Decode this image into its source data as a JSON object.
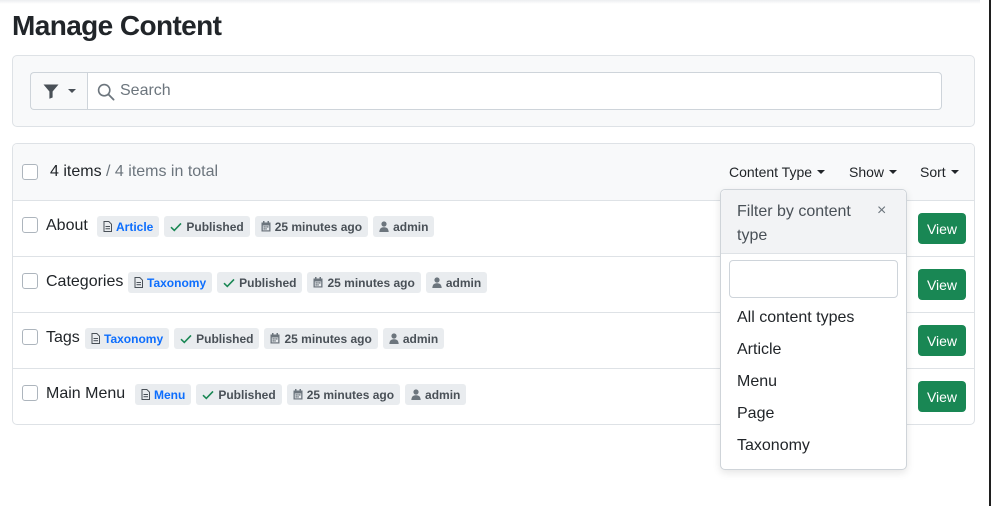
{
  "page": {
    "title": "Manage Content"
  },
  "search": {
    "placeholder": "Search"
  },
  "list": {
    "count_label": "4 items",
    "total_label": " / 4 items in total",
    "controls": {
      "content_type": "Content Type",
      "show": "Show",
      "sort": "Sort"
    },
    "rows": [
      {
        "title": "About",
        "type": "Article",
        "status": "Published",
        "date": "25 minutes ago",
        "author": "admin",
        "action": "View"
      },
      {
        "title": "Categories",
        "type": "Taxonomy",
        "status": "Published",
        "date": "25 minutes ago",
        "author": "admin",
        "action": "View"
      },
      {
        "title": "Tags",
        "type": "Taxonomy",
        "status": "Published",
        "date": "25 minutes ago",
        "author": "admin",
        "action": "View"
      },
      {
        "title": "Main Menu",
        "type": "Menu",
        "status": "Published",
        "date": "25 minutes ago",
        "author": "admin",
        "action": "View"
      }
    ]
  },
  "dropdown": {
    "title": "Filter by content type",
    "close": "×",
    "input_value": "",
    "options": [
      "All content types",
      "Article",
      "Menu",
      "Page",
      "Taxonomy"
    ]
  },
  "colors": {
    "primary": "#0d6efd",
    "success": "#198754",
    "light": "#f8f9fa",
    "border": "#dee2e6"
  },
  "icons": {
    "filter": "filter-icon",
    "search": "search-icon",
    "type": "file-icon",
    "status": "check-icon",
    "date": "calendar-icon",
    "author": "user-icon"
  }
}
